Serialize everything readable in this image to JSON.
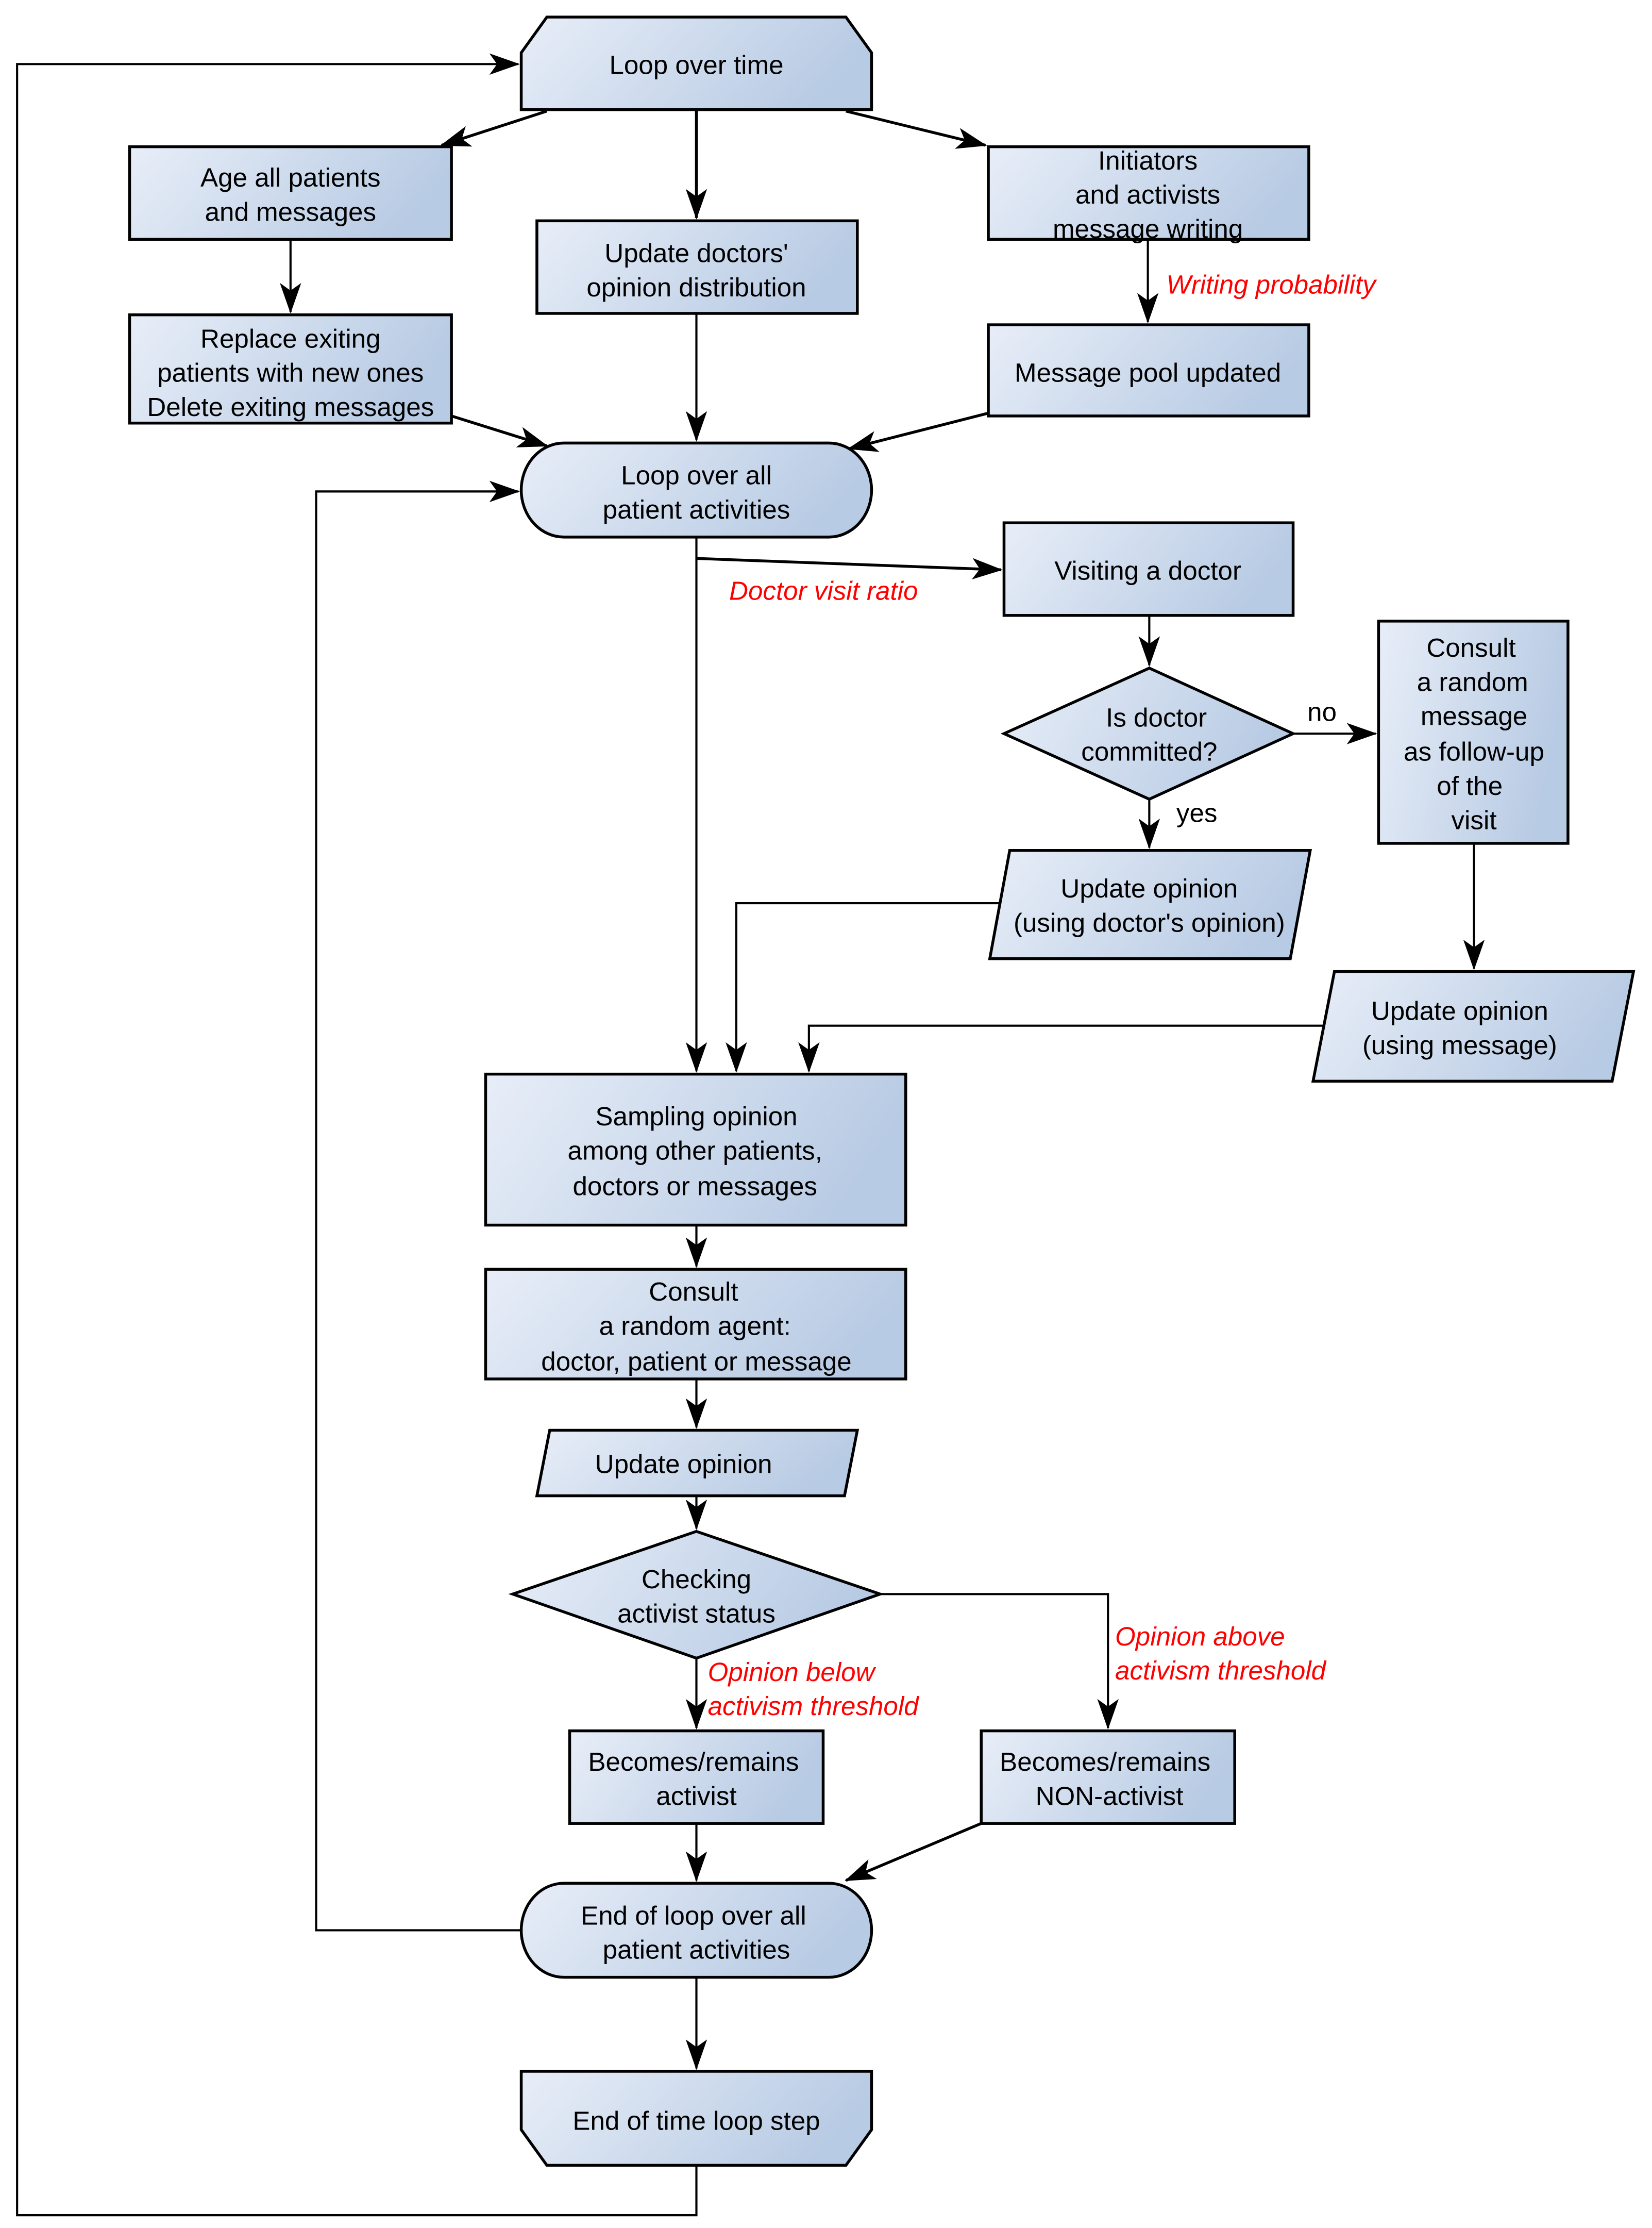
{
  "diagram": {
    "type": "flowchart",
    "colors": {
      "fill_start": "#e8eef8",
      "fill_end": "#b8cbe4",
      "stroke": "#000000",
      "annotation": "#ff0000"
    },
    "nodes": {
      "loop_time": {
        "shape": "loop-start",
        "lines": [
          "Loop over time"
        ]
      },
      "age": {
        "shape": "process",
        "lines": [
          "Age all patients",
          "and messages"
        ]
      },
      "update_doctors": {
        "shape": "process",
        "lines": [
          "Update doctors'",
          "opinion distribution"
        ]
      },
      "initiators": {
        "shape": "process",
        "lines": [
          "Initiators",
          "and activists",
          "message writing"
        ]
      },
      "replace": {
        "shape": "process",
        "lines": [
          "Replace exiting",
          "patients with new ones",
          "Delete exiting messages"
        ]
      },
      "message_pool": {
        "shape": "process",
        "lines": [
          "Message pool updated"
        ]
      },
      "loop_patients": {
        "shape": "terminator",
        "lines": [
          "Loop over all",
          "patient activities"
        ]
      },
      "visiting": {
        "shape": "process",
        "lines": [
          "Visiting a doctor"
        ]
      },
      "is_committed": {
        "shape": "decision",
        "lines": [
          "Is doctor",
          "committed?"
        ]
      },
      "consult_message": {
        "shape": "process",
        "lines": [
          "Consult",
          "a random",
          "message",
          "as follow-up",
          "of the",
          "visit"
        ]
      },
      "update_doctor_opinion": {
        "shape": "data",
        "lines": [
          "Update opinion",
          "(using doctor's opinion)"
        ]
      },
      "update_message_opinion": {
        "shape": "data",
        "lines": [
          "Update opinion",
          "(using message)"
        ]
      },
      "sampling": {
        "shape": "process",
        "lines": [
          "Sampling opinion",
          "among other patients,",
          "doctors or messages"
        ]
      },
      "consult_agent": {
        "shape": "process",
        "lines": [
          "Consult",
          "a random agent:",
          "doctor, patient or message"
        ]
      },
      "update_opinion": {
        "shape": "data",
        "lines": [
          "Update opinion"
        ]
      },
      "checking": {
        "shape": "decision",
        "lines": [
          "Checking",
          "activist status"
        ]
      },
      "activist": {
        "shape": "process",
        "lines": [
          "Becomes/remains",
          "activist"
        ]
      },
      "non_activist": {
        "shape": "process",
        "lines": [
          "Becomes/remains",
          "NON-activist"
        ]
      },
      "end_loop_patients": {
        "shape": "terminator",
        "lines": [
          "End of loop over all",
          "patient activities"
        ]
      },
      "end_time": {
        "shape": "loop-end",
        "lines": [
          "End of time loop step"
        ]
      }
    },
    "edge_labels": {
      "writing_probability": "Writing probability",
      "doctor_visit_ratio": "Doctor visit ratio",
      "no": "no",
      "yes": "yes",
      "opinion_below": [
        "Opinion below",
        "activism threshold"
      ],
      "opinion_above": [
        "Opinion above",
        "activism threshold"
      ]
    },
    "edges": [
      [
        "loop_time",
        "age"
      ],
      [
        "loop_time",
        "update_doctors"
      ],
      [
        "loop_time",
        "initiators"
      ],
      [
        "age",
        "replace"
      ],
      [
        "initiators",
        "message_pool"
      ],
      [
        "replace",
        "loop_patients"
      ],
      [
        "update_doctors",
        "loop_patients"
      ],
      [
        "message_pool",
        "loop_patients"
      ],
      [
        "loop_patients",
        "visiting"
      ],
      [
        "loop_patients",
        "sampling"
      ],
      [
        "visiting",
        "is_committed"
      ],
      [
        "is_committed",
        "consult_message"
      ],
      [
        "is_committed",
        "update_doctor_opinion"
      ],
      [
        "consult_message",
        "update_message_opinion"
      ],
      [
        "update_doctor_opinion",
        "sampling"
      ],
      [
        "update_message_opinion",
        "sampling"
      ],
      [
        "sampling",
        "consult_agent"
      ],
      [
        "consult_agent",
        "update_opinion"
      ],
      [
        "update_opinion",
        "checking"
      ],
      [
        "checking",
        "activist"
      ],
      [
        "checking",
        "non_activist"
      ],
      [
        "activist",
        "end_loop_patients"
      ],
      [
        "non_activist",
        "end_loop_patients"
      ],
      [
        "end_loop_patients",
        "loop_patients"
      ],
      [
        "end_loop_patients",
        "end_time"
      ],
      [
        "end_time",
        "loop_time"
      ]
    ]
  }
}
